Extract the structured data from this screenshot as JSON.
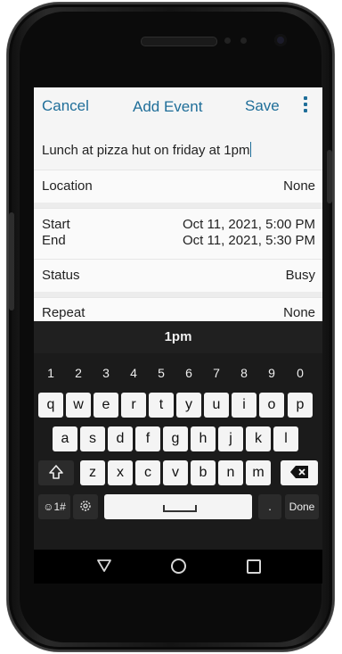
{
  "toolbar": {
    "cancel": "Cancel",
    "title": "Add Event",
    "save": "Save"
  },
  "event": {
    "title_value": "Lunch at pizza hut on friday at 1pm",
    "location_label": "Location",
    "location_value": "None",
    "start_label": "Start",
    "start_value": "Oct 11, 2021, 5:00 PM",
    "end_label": "End",
    "end_value": "Oct 11, 2021, 5:30 PM",
    "status_label": "Status",
    "status_value": "Busy",
    "repeat_label": "Repeat",
    "repeat_value": "None"
  },
  "keyboard": {
    "suggestion": "1pm",
    "numbers": [
      "1",
      "2",
      "3",
      "4",
      "5",
      "6",
      "7",
      "8",
      "9",
      "0"
    ],
    "row1": [
      "q",
      "w",
      "e",
      "r",
      "t",
      "y",
      "u",
      "i",
      "o",
      "p"
    ],
    "row2": [
      "a",
      "s",
      "d",
      "f",
      "g",
      "h",
      "j",
      "k",
      "l"
    ],
    "row3": [
      "z",
      "x",
      "c",
      "v",
      "b",
      "n",
      "m"
    ],
    "symbols_label": "☺1#",
    "period_label": ".",
    "done_label": "Done"
  },
  "icons": {
    "overflow_menu": "vertical-dots",
    "shift": "shift-arrow",
    "backspace": "backspace",
    "settings": "gear",
    "space": "space-bar",
    "nav_back": "triangle-back",
    "nav_home": "circle-home",
    "nav_recent": "square-recents"
  },
  "colors": {
    "accent": "#1f6e99",
    "keyboard_bg": "#1b1b1b",
    "app_bg": "#f5f5f5"
  }
}
